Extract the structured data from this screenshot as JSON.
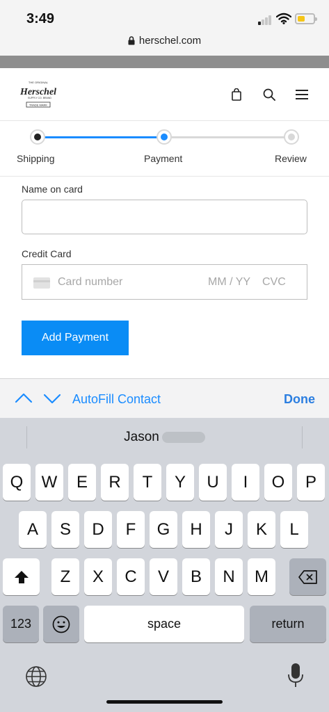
{
  "status_bar": {
    "time": "3:49"
  },
  "browser": {
    "url": "herschel.com"
  },
  "header": {
    "logo": {
      "text_lines": [
        "THE ORIGINAL",
        "Herschel",
        "SUPPLY CO. BRAND",
        "TRADE MARK"
      ]
    }
  },
  "steps": [
    {
      "label": "Shipping",
      "state": "completed"
    },
    {
      "label": "Payment",
      "state": "active"
    },
    {
      "label": "Review",
      "state": "upcoming"
    }
  ],
  "form": {
    "name_label": "Name on card",
    "name_value": "",
    "card_label": "Credit Card",
    "card_number_placeholder": "Card number",
    "expiry_placeholder": "MM / YY",
    "cvc_placeholder": "CVC",
    "submit_label": "Add Payment"
  },
  "autofill": {
    "label": "AutoFill Contact",
    "done_label": "Done"
  },
  "keyboard": {
    "suggestion": "Jason",
    "rows": [
      [
        "Q",
        "W",
        "E",
        "R",
        "T",
        "Y",
        "U",
        "I",
        "O",
        "P"
      ],
      [
        "A",
        "S",
        "D",
        "F",
        "G",
        "H",
        "J",
        "K",
        "L"
      ],
      [
        "Z",
        "X",
        "C",
        "V",
        "B",
        "N",
        "M"
      ]
    ],
    "numbers_label": "123",
    "space_label": "space",
    "return_label": "return"
  },
  "colors": {
    "accent": "#1a8cff",
    "button": "#0a8cf5",
    "step_done": "#222222",
    "battery": "#f5c518",
    "signal_on": "#222222",
    "signal_off": "#c8c8c8",
    "line_inactive": "#d8d8d8",
    "icon_blue": "#2b7ee0"
  },
  "icons": {
    "lock": "lock-icon",
    "bag": "bag-icon",
    "search": "search-icon",
    "menu": "menu-icon",
    "shift": "shift-icon",
    "backspace": "backspace-icon",
    "emoji": "emoji-icon",
    "globe": "globe-icon",
    "mic": "mic-icon",
    "card": "credit-card-icon"
  }
}
